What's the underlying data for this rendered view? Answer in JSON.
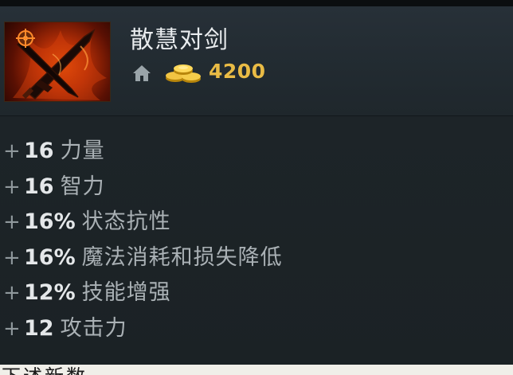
{
  "item": {
    "name": "散慧对剑",
    "cost": "4200",
    "icon": "crossed-swords-icon"
  },
  "icons": {
    "shop": "home-icon",
    "gold": "gold-coins-icon"
  },
  "attributes": [
    {
      "prefix": "+",
      "value": "16",
      "name": "力量"
    },
    {
      "prefix": "+",
      "value": "16",
      "name": "智力"
    },
    {
      "prefix": "+",
      "value": "16%",
      "name": "状态抗性"
    },
    {
      "prefix": "+",
      "value": "16%",
      "name": "魔法消耗和损失降低"
    },
    {
      "prefix": "+",
      "value": "12%",
      "name": "技能增强"
    },
    {
      "prefix": "+",
      "value": "12",
      "name": "攻击力"
    }
  ],
  "colors": {
    "gold_text": "#e9bb45",
    "title_text": "#e9ecee",
    "value_text": "#e4e7e9",
    "label_text": "#aab1b5",
    "panel_bg": "#1c2327"
  },
  "bottom_strip_text": "下述新数"
}
